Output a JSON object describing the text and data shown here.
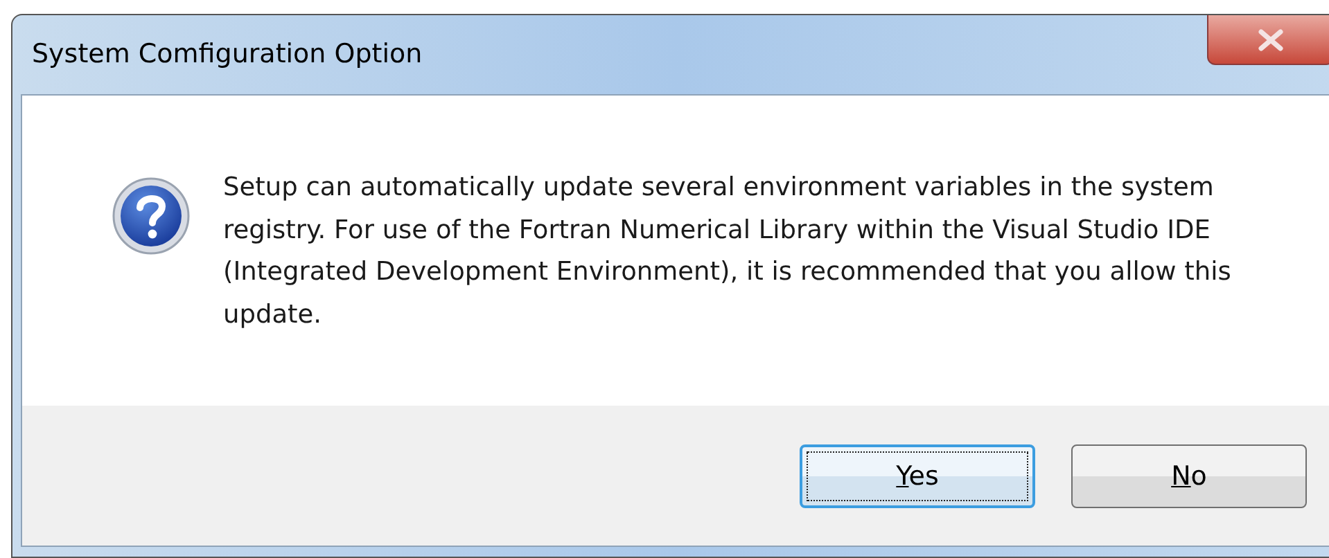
{
  "window": {
    "title": "System Comfiguration Option"
  },
  "message": "Setup can automatically update several environment variables in the system registry. For use of the Fortran Numerical Library within the Visual Studio IDE (Integrated Development Environment), it is recommended that you allow this update.",
  "buttons": [
    {
      "mnemonic": "Y",
      "rest": "es",
      "default": true
    },
    {
      "mnemonic": "N",
      "rest": "o",
      "default": false
    }
  ]
}
